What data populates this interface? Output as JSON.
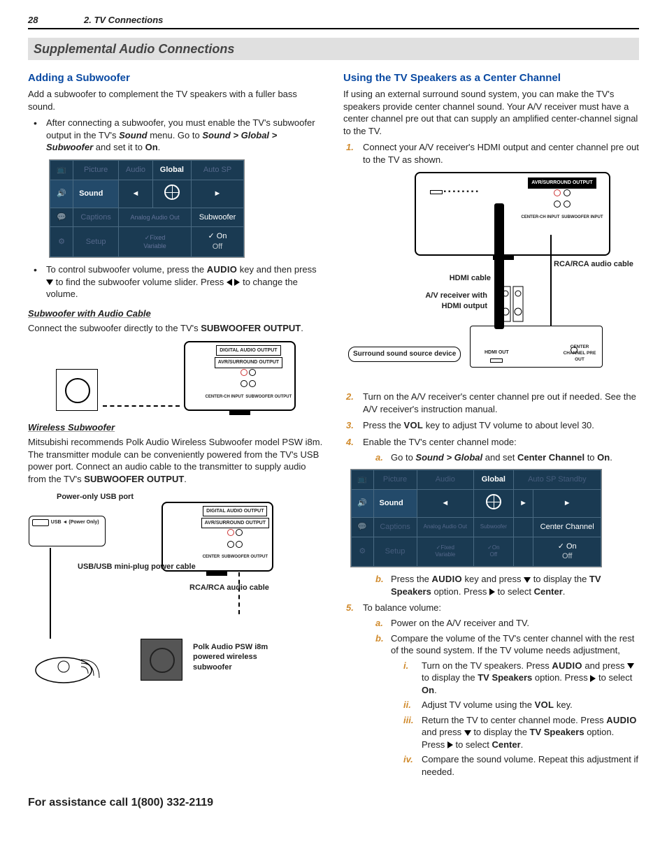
{
  "header": {
    "page": "28",
    "chapter": "2. TV Connections"
  },
  "banner": "Supplemental Audio Connections",
  "left": {
    "h_add": "Adding a Subwoofer",
    "p_intro": "Add a subwoofer to complement the TV speakers with a fuller bass sound.",
    "b1a": "After connecting a subwoofer, you must enable the TV's subwoofer output in the TV's ",
    "b1b": " menu.  Go to ",
    "b1c": " and set it to ",
    "sound": "Sound",
    "path1": "Sound > Global > Subwoofer",
    "on": "On",
    "b2a": "To control subwoofer volume, press the ",
    "audio_key": "AUDIO",
    "b2b": " key and then press ",
    "b2c": " to find the subwoofer volume slider.  Press ",
    "b2d": " to change the volume.",
    "h_cable": "Subwoofer with Audio Cable",
    "p_cable": "Connect the subwoofer directly to the TV's ",
    "sub_out": "SUBWOOFER OUTPUT",
    "h_wireless": "Wireless Subwoofer",
    "p_wireless1": "Mitsubishi recommends Polk Audio Wireless Subwoofer model PSW i8m.  The transmitter module can be conveniently powered from the TV's USB power port.  Connect an audio cable to the transmitter to supply audio from the TV's ",
    "d2_usb": "Power-only USB port",
    "d2_usbcable": "USB/USB mini-plug power cable",
    "d2_rca": "RCA/RCA audio cable",
    "d2_psw": "Polk Audio PSW i8m powered wireless subwoofer",
    "port_digital": "DIGITAL AUDIO OUTPUT",
    "port_avr": "AVR/SURROUND OUTPUT",
    "port_center": "CENTER-CH INPUT",
    "port_sub": "SUBWOOFER OUTPUT",
    "port_usb_lab": "USB ◄ (Power Only)"
  },
  "right": {
    "h_center": "Using the TV Speakers as a Center Channel",
    "p_intro": "If using an external surround sound system, you can make the TV's speakers provide center channel sound.  Your A/V receiver must have a center channel pre out that can supply an amplified center-channel signal to the TV.",
    "s1": "Connect your A/V receiver's HDMI output and center channel pre out to the TV as shown.",
    "d_hdmi": "HDMI cable",
    "d_rca": "RCA/RCA audio cable",
    "d_avr": "A/V receiver with HDMI output",
    "d_src": "Surround sound source device",
    "d_hdmiout": "HDMI OUT",
    "d_preout": "CENTER CHANNEL PRE OUT",
    "d_center_in": "CENTER-CH INPUT",
    "d_sub_in": "SUBWOOFER INPUT",
    "d_avr_out": "AVR/SURROUND OUTPUT",
    "s2": "Turn on the A/V receiver's center channel pre out if needed.  See the A/V receiver's instruction manual.",
    "s3a": "Press the ",
    "vol_key": "VOL",
    "s3b": " key to adjust TV volume to about level 30.",
    "s4": "Enable the TV's center channel mode:",
    "s4a1": "Go to ",
    "path2": "Sound > Global",
    "s4a2": " and set ",
    "cc": "Center Channel",
    "s4a3": " to ",
    "s4b1": "Press the ",
    "s4b2": " key and press ",
    "s4b3": " to display the ",
    "tvspk": "TV Speakers",
    "s4b4": " option.  Press ",
    "s4b5": " to select ",
    "center": "Center",
    "s5": "To balance volume:",
    "s5a": "Power on the A/V receiver and TV.",
    "s5b": "Compare the volume of the TV's center channel with the rest of the sound system.  If the TV volume needs adjustment,",
    "s5bi1": "Turn on the TV speakers.  Press ",
    "s5bi2": " and press ",
    "s5bi3": " to display the ",
    "s5bi4": " option.  Press ",
    "s5bi5": " to select ",
    "s5bii": "Adjust TV volume using the ",
    "s5bii2": " key.",
    "s5biii1": "Return the TV to center channel mode.  Press ",
    "s5biii2": " and press ",
    "s5biii3": " to display the ",
    "s5biii4": " option.  Press ",
    "s5biii5": " to select ",
    "s5biv": "Compare the sound volume.  Repeat this adjustment if needed."
  },
  "menu1": {
    "rows": [
      [
        "",
        "Picture",
        "Audio",
        "Global",
        "Auto SP"
      ],
      [
        "🔊",
        "Sound",
        "◄",
        "GLOBE",
        "►"
      ],
      [
        "",
        "Captions",
        "Analog Audio Out",
        "",
        "Subwoofer"
      ],
      [
        "",
        "Setup",
        "✓Fixed",
        "",
        "✓ On"
      ],
      [
        "",
        "",
        "Variable",
        "",
        "Off"
      ]
    ]
  },
  "menu2": {
    "rows": [
      [
        "",
        "Picture",
        "Audio",
        "Global",
        "Auto SP Standby",
        ""
      ],
      [
        "🔊",
        "Sound",
        "◄",
        "GLOBE",
        "►",
        "►"
      ],
      [
        "",
        "Captions",
        "Analog Audio Out",
        "Subwoofer",
        "",
        "Center Channel"
      ],
      [
        "",
        "Setup",
        "✓Fixed",
        "✓On",
        "",
        "✓ On"
      ],
      [
        "",
        "",
        "Variable",
        "Off",
        "",
        "Off"
      ]
    ]
  },
  "footer": "For assistance call 1(800) 332-2119"
}
